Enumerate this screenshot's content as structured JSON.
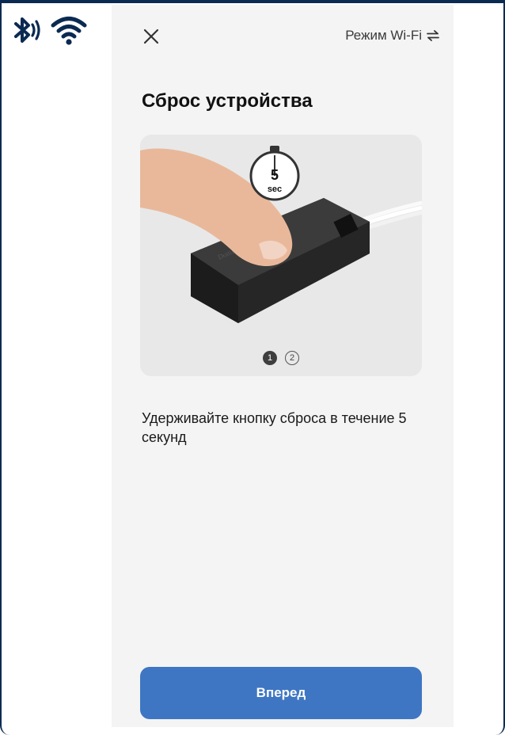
{
  "status_bar": {
    "icons": [
      "bluetooth-icon",
      "wifi-icon"
    ],
    "color": "#0b2a52"
  },
  "header": {
    "close_icon": "close-icon",
    "mode_label": "Режим Wi-Fi",
    "mode_icon": "swap-arrows-icon"
  },
  "page": {
    "title": "Сброс устройства"
  },
  "illustration": {
    "timer_value": "5",
    "timer_unit": "sec",
    "device_brand": "DomRus",
    "pager": [
      "1",
      "2"
    ],
    "active_page": 1
  },
  "instruction": "Удерживайте кнопку сброса в течение 5 секунд",
  "actions": {
    "next_label": "Вперед",
    "accent": "#3e76c3"
  }
}
